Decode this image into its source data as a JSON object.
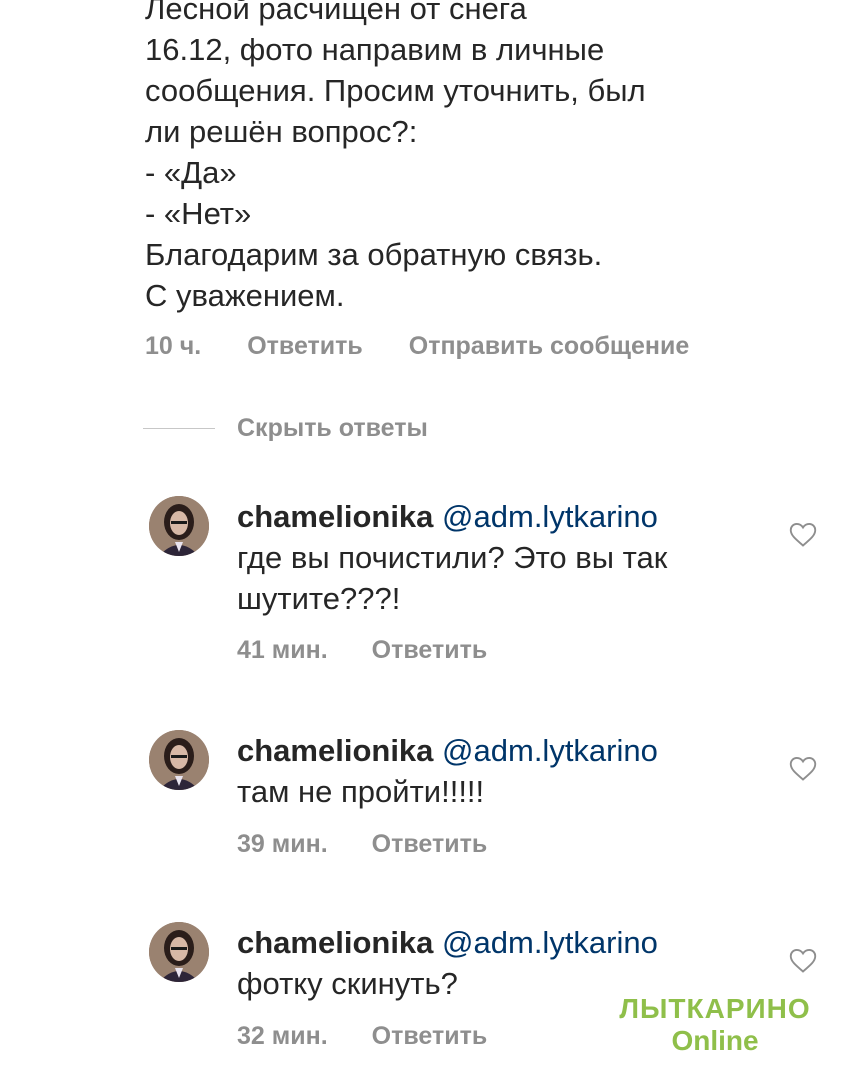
{
  "parent_comment": {
    "text_lines": [
      "Лесной расчищен от снега",
      "16.12, фото направим в личные",
      "сообщения. Просим уточнить, был",
      "ли решён вопрос?:",
      "- «Да»",
      "- «Нет»",
      "Благодарим за обратную связь.",
      "С уважением."
    ],
    "time": "10 ч.",
    "reply_label": "Ответить",
    "send_message_label": "Отправить сообщение"
  },
  "hide_replies_label": "Скрыть ответы",
  "replies": [
    {
      "username": "chamelionika",
      "mention": "@adm.lytkarino",
      "text_first": "где вы почистили? Это вы так",
      "text_second": "шутите???!",
      "time": "41 мин.",
      "reply_label": "Ответить"
    },
    {
      "username": "chamelionika",
      "mention": "@adm.lytkarino",
      "text_first": "там не пройти!!!!!",
      "time": "39 мин.",
      "reply_label": "Ответить"
    },
    {
      "username": "chamelionika",
      "mention": "@adm.lytkarino",
      "text_first": "фотку скинуть?",
      "time": "32 мин.",
      "reply_label": "Ответить"
    }
  ],
  "watermark": {
    "line1": "ЛЫТКАРИНО",
    "line2": "Online"
  },
  "colors": {
    "text": "#262626",
    "muted": "#8e8e8e",
    "mention": "#003569",
    "watermark": "#8fbf4a"
  },
  "icons": {
    "like": "heart-outline-icon"
  }
}
